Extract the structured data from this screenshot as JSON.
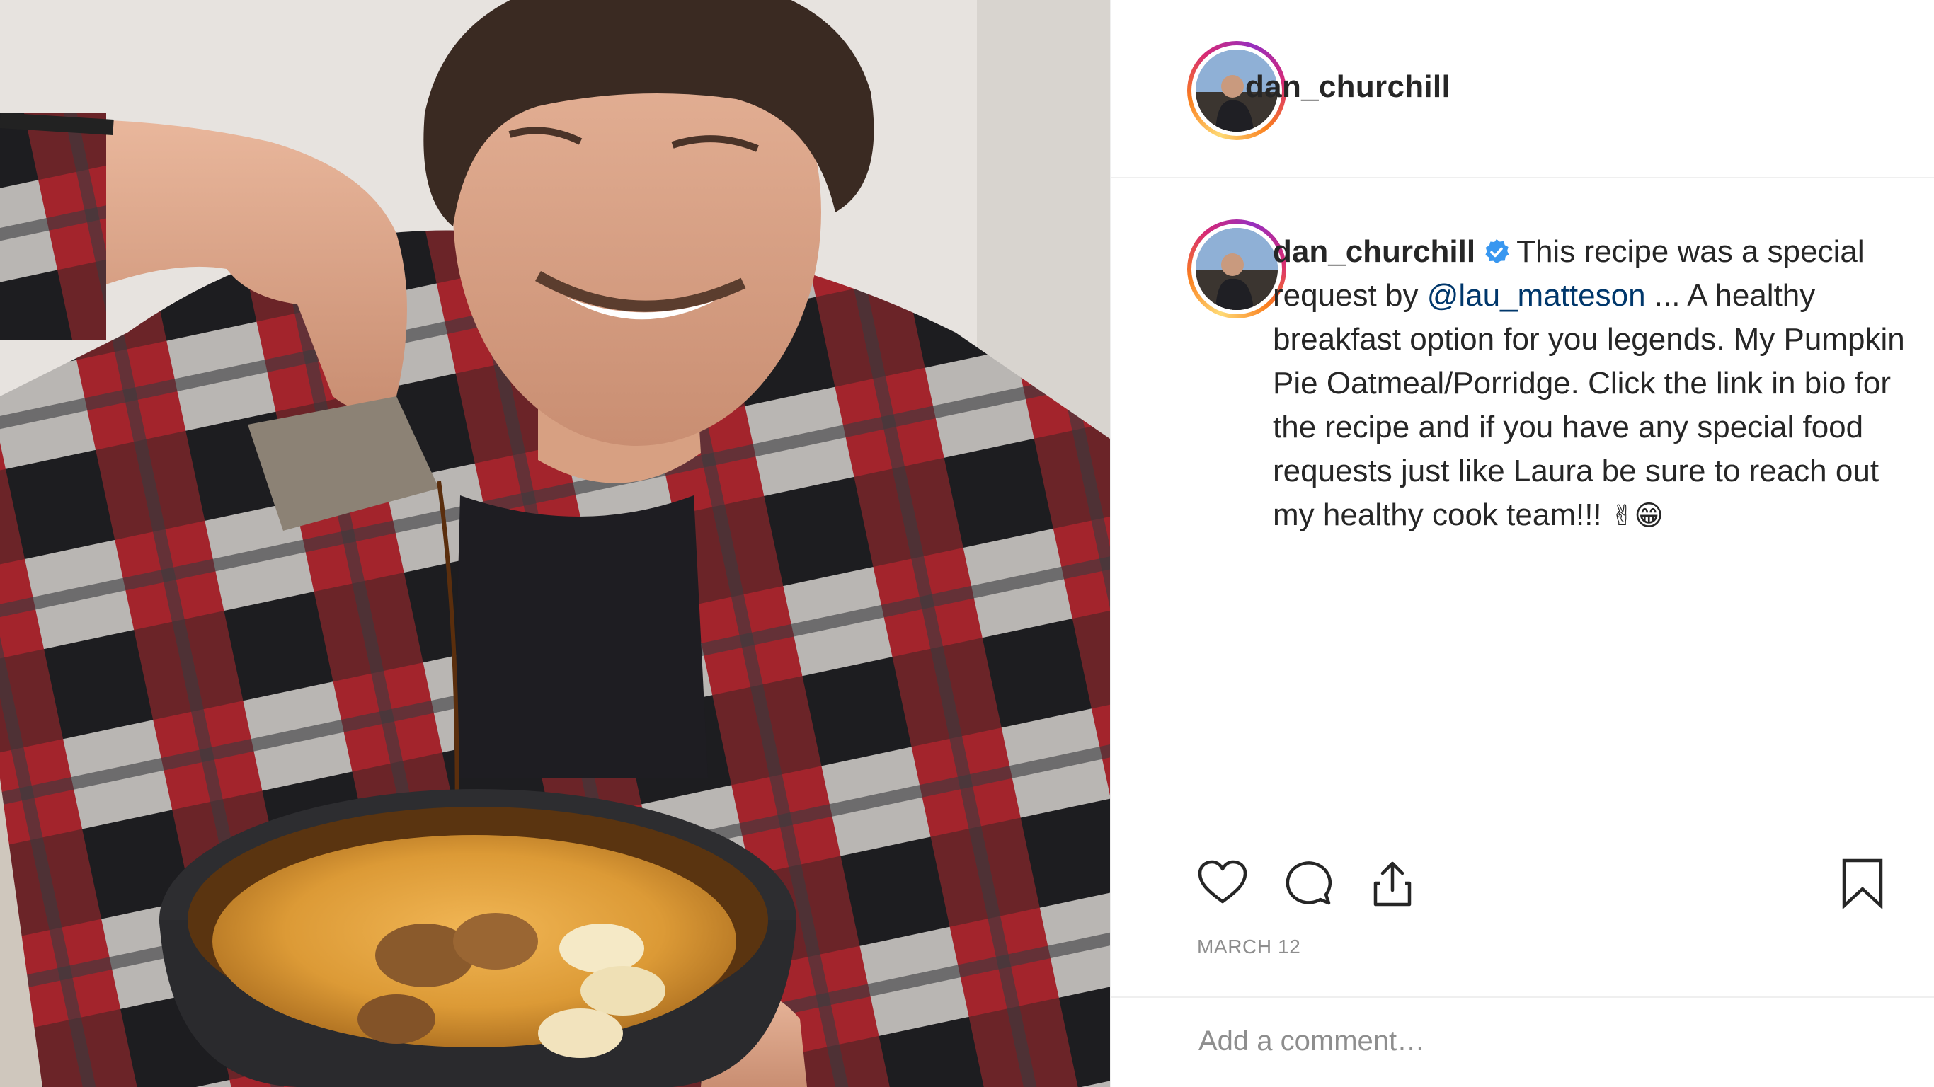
{
  "post": {
    "username": "dan_churchill",
    "verified": true,
    "caption": {
      "username": "dan_churchill",
      "text_before_mention": "This recipe was a special request by",
      "mention": "@lau_matteson",
      "text_after_mention": "... A healthy breakfast option for you legends. My Pumpkin Pie Oatmeal/Porridge. Click the link in bio for the recipe and if you have any special food requests just like Laura be sure to reach out my healthy cook team!!!",
      "emojis": "✌😁"
    },
    "date": "MARCH 12",
    "comment_placeholder": "Add a comment…"
  },
  "icons": {
    "like": "heart-icon",
    "comment": "comment-icon",
    "share": "share-icon",
    "save": "bookmark-icon",
    "verified": "verified-badge-icon"
  },
  "colors": {
    "text": "#262626",
    "muted": "#8e8e8e",
    "mention": "#00376b",
    "verified": "#3897f0",
    "divider": "#efefef"
  }
}
